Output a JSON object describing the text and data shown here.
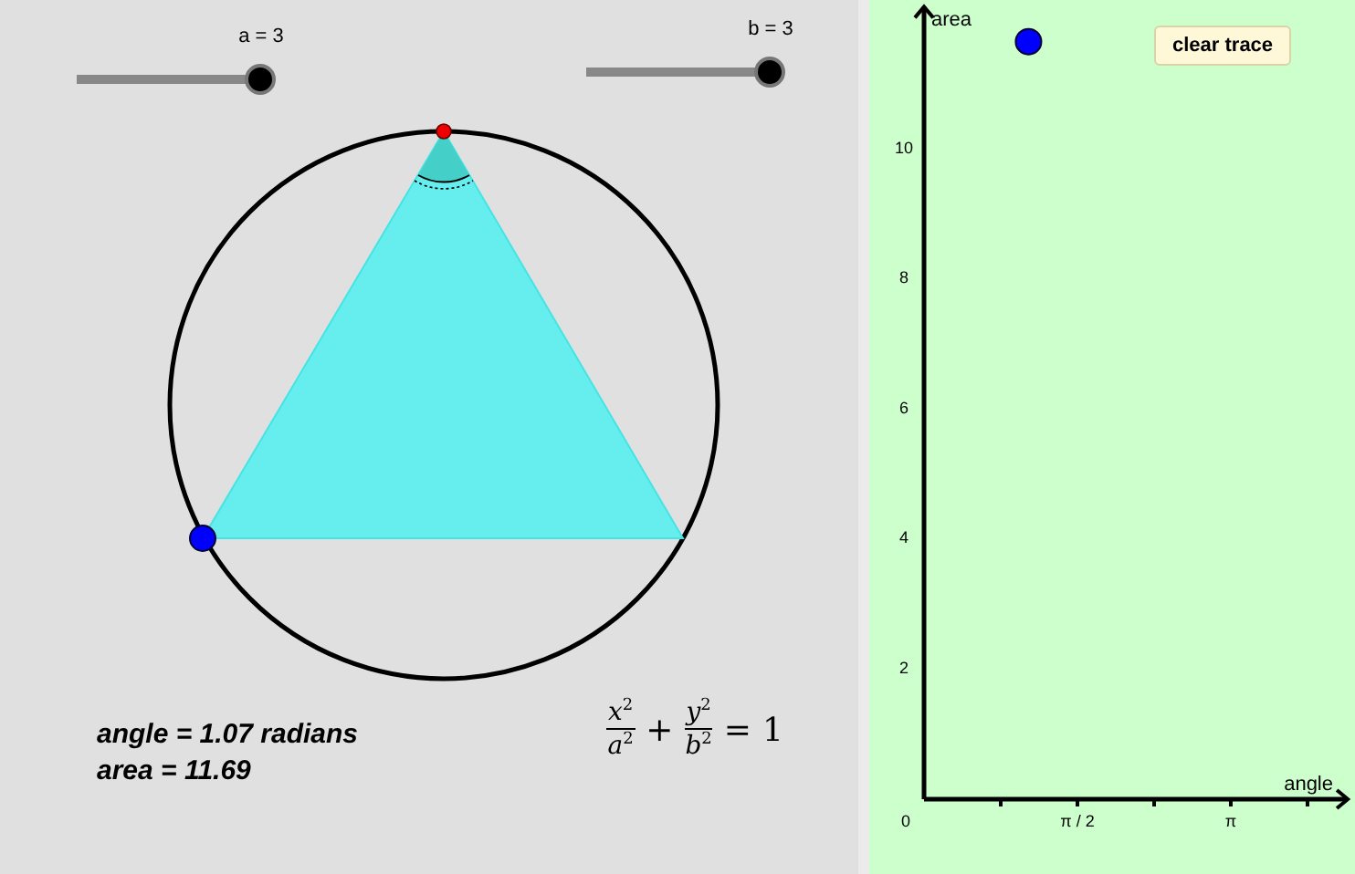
{
  "sliders": [
    {
      "label": "a = 3",
      "level": 1
    },
    {
      "label": "b = 3",
      "level": 1
    }
  ],
  "readouts": [
    "angle = 1.07 radians",
    "area = 11.69"
  ],
  "equation": {
    "fractions": [
      {
        "numerator": "x",
        "numerator_exponent": "2",
        "denominator": "a",
        "denominator_exponent": "2"
      },
      {
        "numerator": "y",
        "numerator_exponent": "2",
        "denominator": "b",
        "denominator_exponent": "2"
      }
    ],
    "plus": "+",
    "equals": "=",
    "rhs": "1"
  },
  "graph": {
    "button": "clear trace",
    "chart_data": {
      "type": "scatter",
      "xlabel": "angle",
      "ylabel": "area",
      "x": [
        1.07
      ],
      "series": [
        {
          "color": "#0000ff",
          "values": [
            11.69
          ]
        }
      ],
      "xlim": [
        0,
        4.34
      ],
      "ylim": [
        0,
        12.2
      ],
      "xticks": [
        {
          "value": 0,
          "label": "0"
        },
        {
          "value": 1.5708,
          "label": "π / 2"
        },
        {
          "value": 3.1416,
          "label": "π"
        }
      ],
      "yticks": [
        2,
        4,
        6,
        8,
        10
      ]
    }
  }
}
